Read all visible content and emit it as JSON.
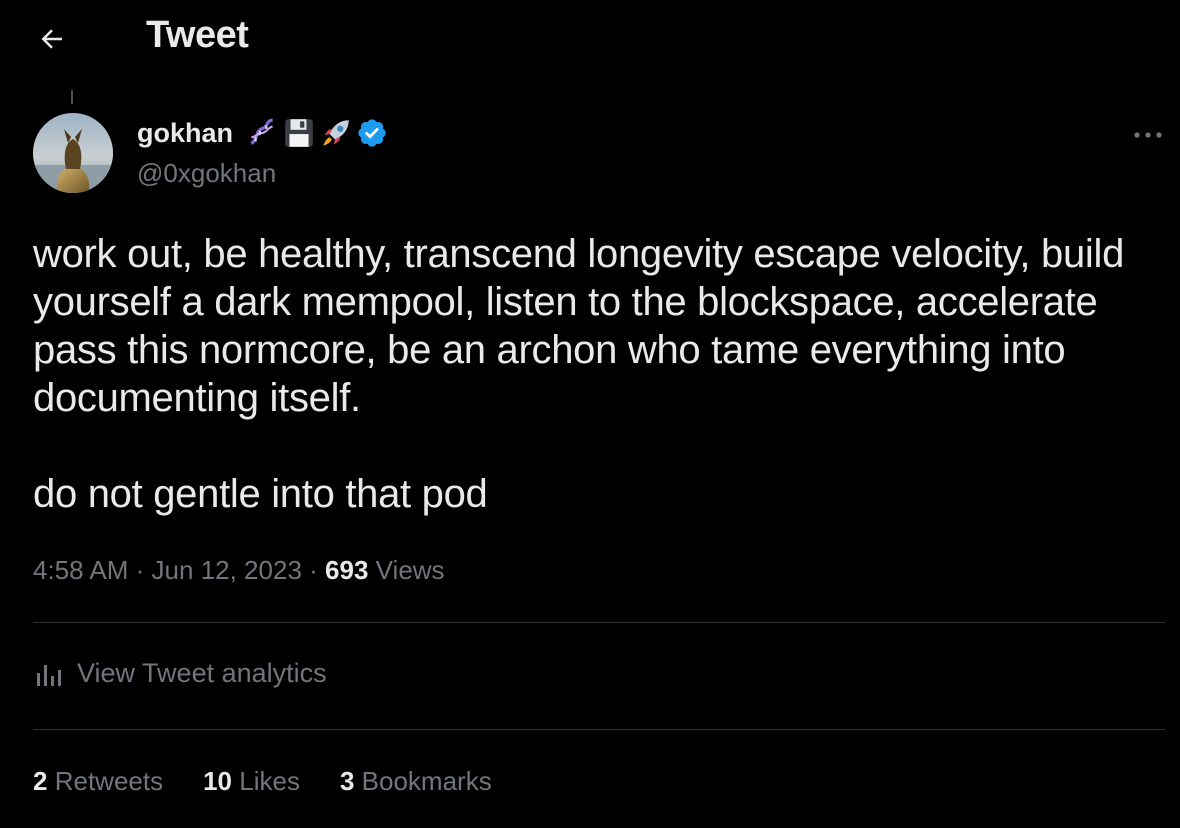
{
  "header": {
    "title": "Tweet",
    "back_icon": "arrow-left-icon"
  },
  "author": {
    "name": "gokhan",
    "handle": "@0xgokhan",
    "emoji_icons": [
      "dna-icon",
      "floppy-disk-icon",
      "rocket-icon"
    ],
    "verified_icon": "verified-badge-icon",
    "verified_color": "#1d9bf0"
  },
  "tweet": {
    "paragraphs": [
      "work out, be healthy, transcend longevity escape velocity, build yourself a dark mempool, listen to the blockspace, accelerate pass this normcore, be an archon who tame everything into documenting itself.",
      "do not gentle into that pod"
    ]
  },
  "meta": {
    "time": "4:58 AM",
    "sep1": "·",
    "date": "Jun 12, 2023",
    "sep2": "·",
    "views_count": "693",
    "views_label": "Views"
  },
  "analytics": {
    "label": "View Tweet analytics",
    "icon": "bar-chart-icon"
  },
  "stats": {
    "retweets_count": "2",
    "retweets_label": "Retweets",
    "likes_count": "10",
    "likes_label": "Likes",
    "bookmarks_count": "3",
    "bookmarks_label": "Bookmarks"
  },
  "colors": {
    "background": "#000000",
    "text": "#e7e9ea",
    "secondary": "#71767b",
    "divider": "#2f3336"
  }
}
